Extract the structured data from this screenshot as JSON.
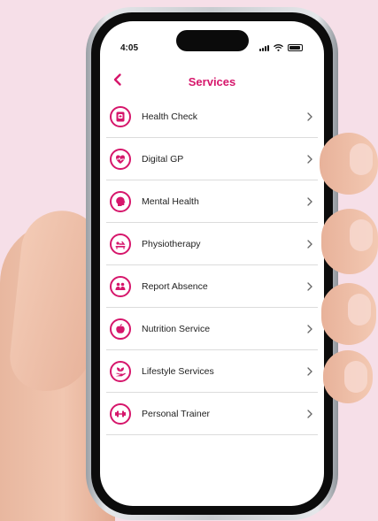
{
  "status": {
    "time": "4:05"
  },
  "header": {
    "title": "Services"
  },
  "services": [
    {
      "label": "Health Check",
      "icon": "health-check-icon"
    },
    {
      "label": "Digital GP",
      "icon": "heart-pulse-icon"
    },
    {
      "label": "Mental Health",
      "icon": "head-icon"
    },
    {
      "label": "Physiotherapy",
      "icon": "massage-icon"
    },
    {
      "label": "Report Absence",
      "icon": "people-icon"
    },
    {
      "label": "Nutrition Service",
      "icon": "apple-icon"
    },
    {
      "label": "Lifestyle Services",
      "icon": "leaf-hand-icon"
    },
    {
      "label": "Personal Trainer",
      "icon": "dumbbell-icon"
    }
  ],
  "colors": {
    "accent": "#d6166b",
    "background": "#f6dfe8"
  }
}
